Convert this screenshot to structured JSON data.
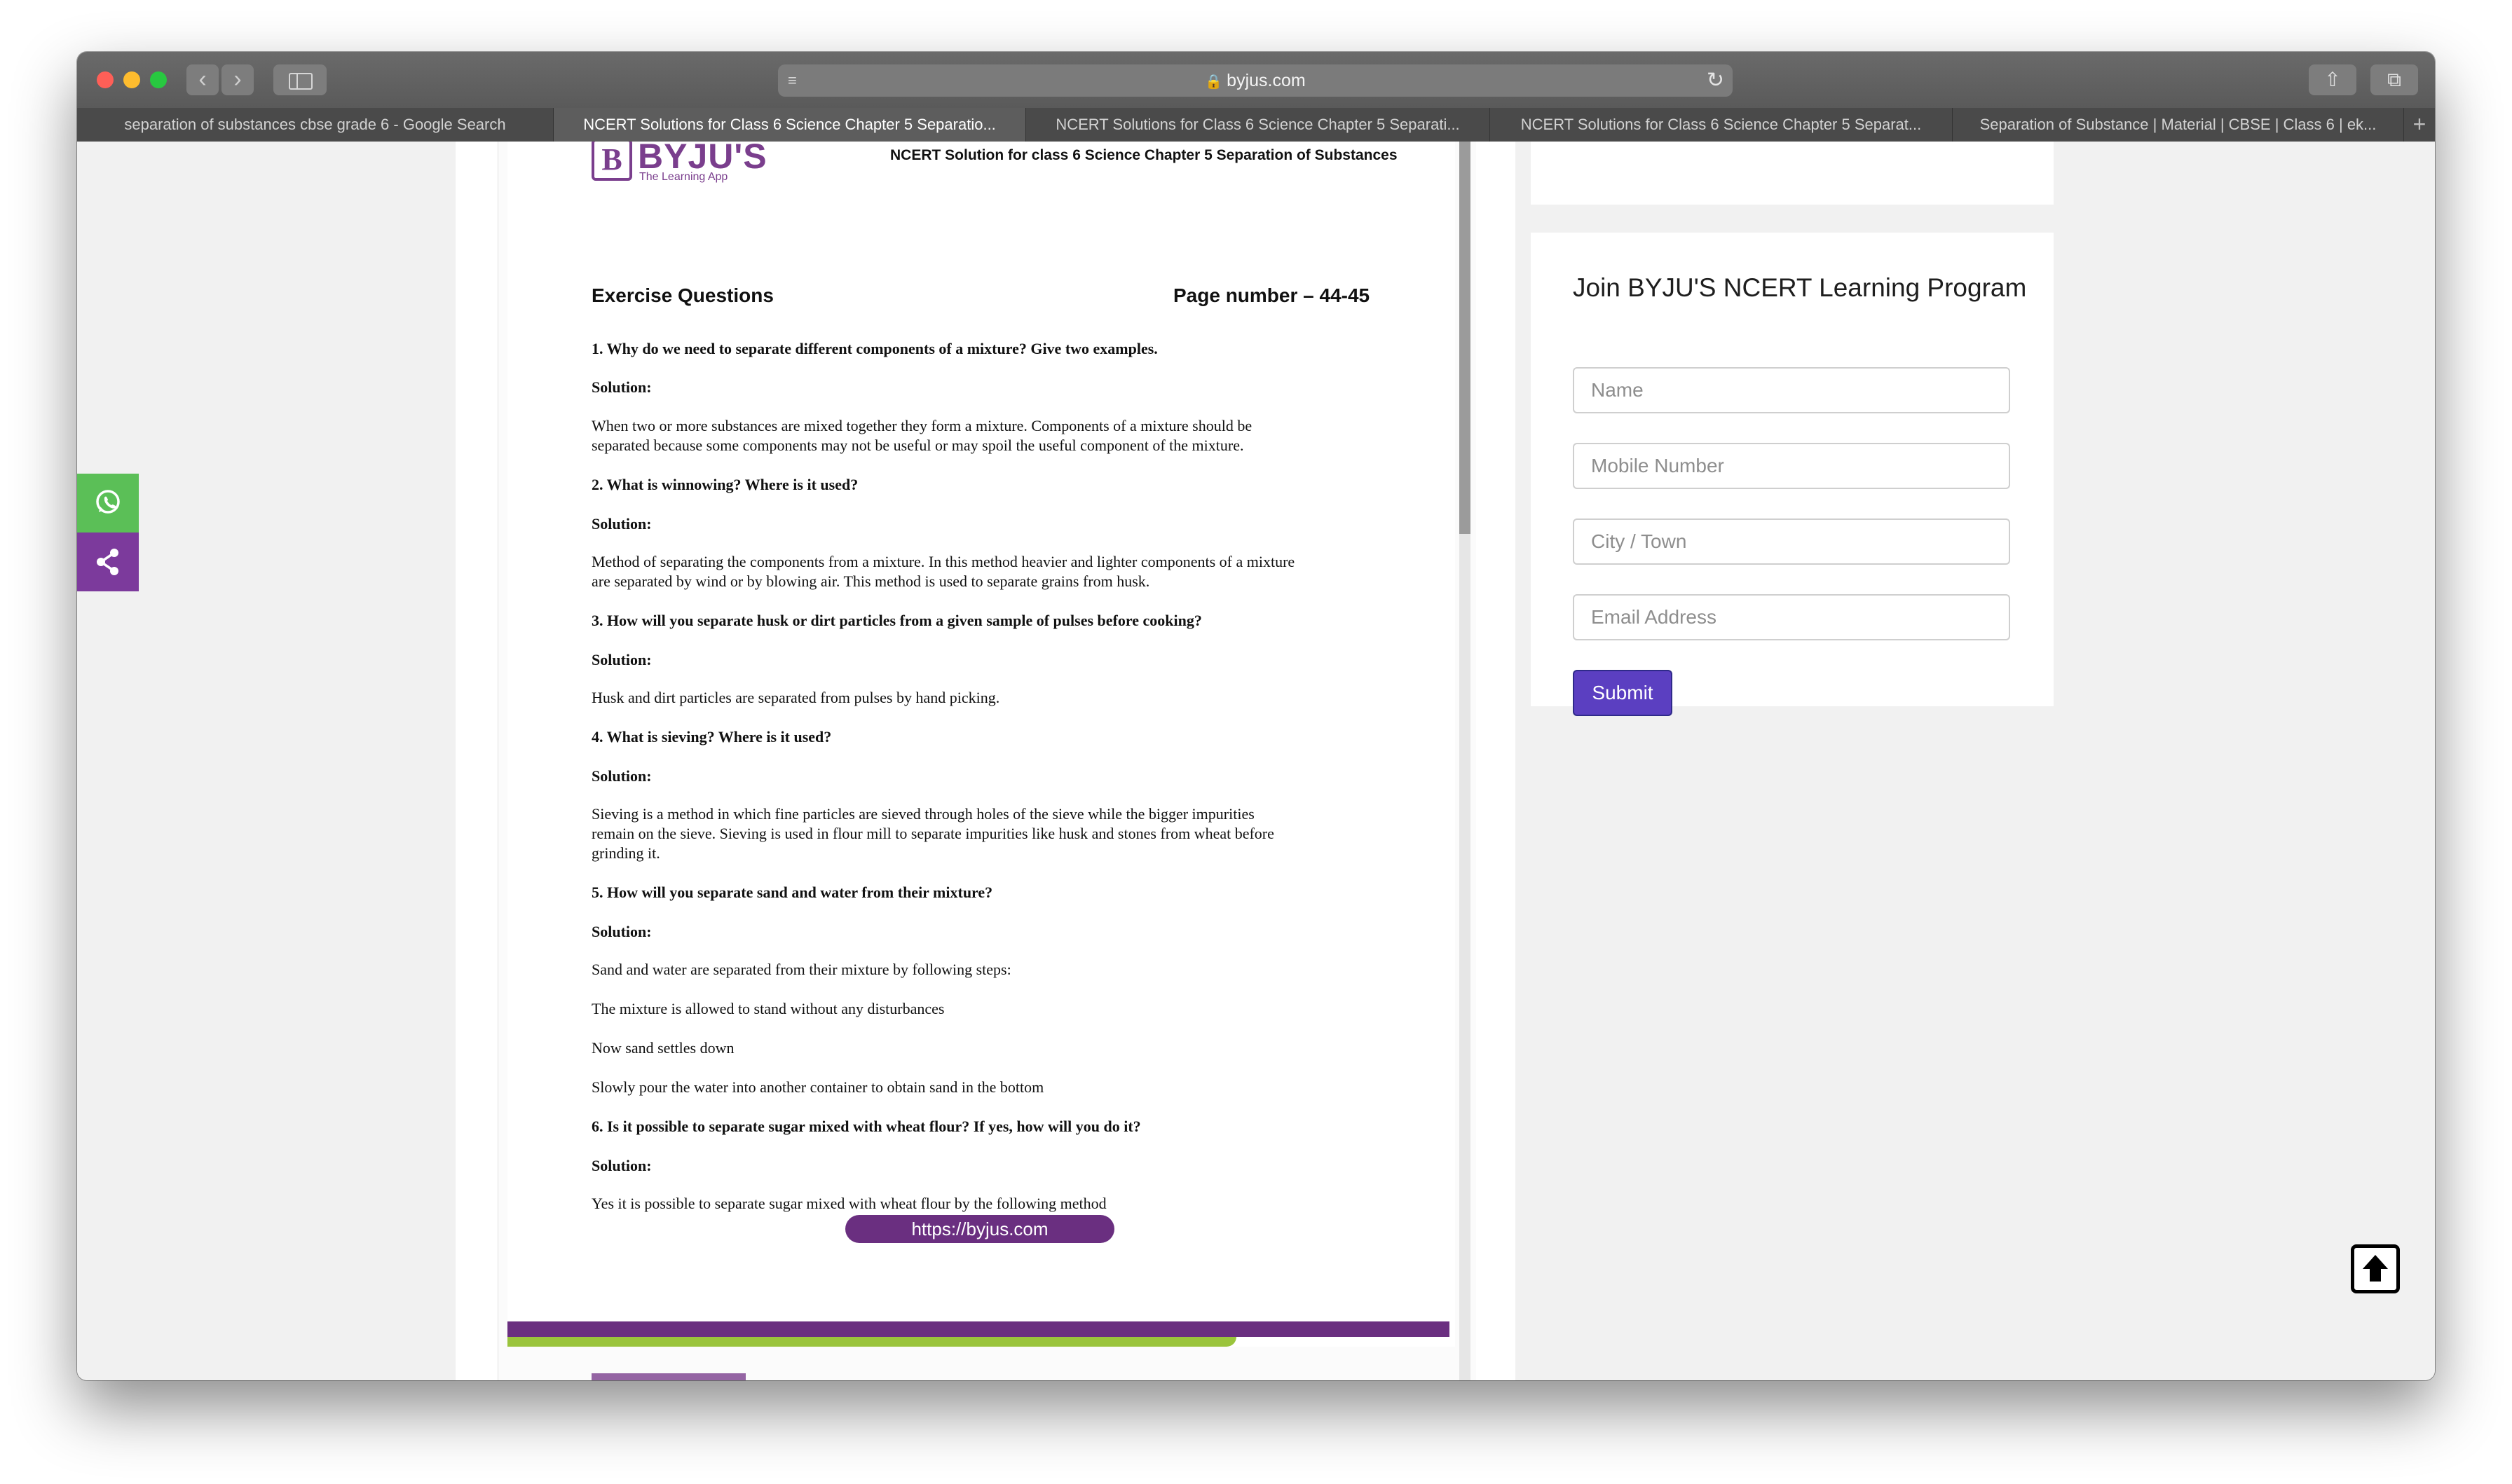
{
  "browser": {
    "url": "byjus.com",
    "tabs": [
      {
        "label": "separation of substances cbse grade 6 - Google Search",
        "active": false
      },
      {
        "label": "NCERT Solutions for Class 6 Science Chapter 5 Separatio...",
        "active": true
      },
      {
        "label": "NCERT Solutions for Class 6 Science Chapter 5 Separati...",
        "active": false
      },
      {
        "label": "NCERT Solutions for Class 6 Science Chapter 5 Separat...",
        "active": false
      },
      {
        "label": "Separation of Substance | Material | CBSE | Class 6 | ek...",
        "active": false
      }
    ],
    "new_tab": "+"
  },
  "pdf": {
    "logo_letter": "B",
    "logo_text": "BYJU'S",
    "logo_tagline": "The Learning App",
    "header_title": "NCERT Solution for class 6 Science Chapter 5 Separation of Substances",
    "exercise_heading": "Exercise Questions",
    "page_number": "Page number – 44-45",
    "lines": [
      {
        "text": "1. Why do we need to separate different components of a mixture? Give two examples.",
        "kind": "q"
      },
      {
        "text": "Solution:",
        "kind": "sol"
      },
      {
        "text": "When two or more substances are mixed together they form a mixture. Components of a mixture should be",
        "kind": "a"
      },
      {
        "text": "separated because some components may not be useful or may spoil the useful component of the mixture.",
        "kind": "a"
      },
      {
        "text": "2. What is winnowing? Where is it used?",
        "kind": "q"
      },
      {
        "text": "Solution:",
        "kind": "sol"
      },
      {
        "text": "Method of separating the components from a mixture. In this method heavier and lighter components of a mixture",
        "kind": "a"
      },
      {
        "text": "are separated by wind or by blowing air. This method is used to separate grains from husk.",
        "kind": "a"
      },
      {
        "text": "3. How will you separate husk or dirt particles from a given sample of pulses before cooking?",
        "kind": "q"
      },
      {
        "text": "Solution:",
        "kind": "sol"
      },
      {
        "text": "Husk and dirt particles are separated from pulses by hand picking.",
        "kind": "a"
      },
      {
        "text": "4. What is sieving? Where is it used?",
        "kind": "q"
      },
      {
        "text": "Solution:",
        "kind": "sol"
      },
      {
        "text": "Sieving is a method in which fine particles are sieved through holes of the sieve while the bigger impurities",
        "kind": "a"
      },
      {
        "text": "remain on the sieve. Sieving is used in flour mill to separate impurities like husk and stones from wheat before",
        "kind": "a"
      },
      {
        "text": "grinding it.",
        "kind": "a"
      },
      {
        "text": "5. How will you separate sand and water from their mixture?",
        "kind": "q"
      },
      {
        "text": "Solution:",
        "kind": "sol"
      },
      {
        "text": "Sand and water are separated from their mixture by following steps:",
        "kind": "a"
      },
      {
        "text": "The mixture is allowed to stand without any disturbances",
        "kind": "a"
      },
      {
        "text": "Now sand settles down",
        "kind": "a"
      },
      {
        "text": "Slowly pour the water into another container to obtain sand in the bottom",
        "kind": "a"
      },
      {
        "text": "6. Is it possible to separate sugar mixed with wheat flour? If yes, how will you do it?",
        "kind": "q"
      },
      {
        "text": "Solution:",
        "kind": "sol"
      },
      {
        "text": "Yes it is possible to separate sugar mixed with wheat flour by the following method",
        "kind": "a"
      }
    ],
    "footer_link": "https://byjus.com"
  },
  "form": {
    "title": "Join BYJU'S NCERT Learning Program",
    "name_placeholder": "Name",
    "mobile_placeholder": "Mobile Number",
    "city_placeholder": "City / Town",
    "email_placeholder": "Email Address",
    "submit_label": "Submit"
  },
  "colors": {
    "brand_purple": "#6a2f80",
    "submit_purple": "#5b3fc1",
    "whatsapp_green": "#5bbf57",
    "accent_green": "#9ac43c"
  },
  "icons": {
    "whatsapp": "whatsapp-icon",
    "share": "share-icon",
    "scroll_top": "arrow-up-icon",
    "lock": "lock-icon",
    "reload": "reload-icon"
  }
}
